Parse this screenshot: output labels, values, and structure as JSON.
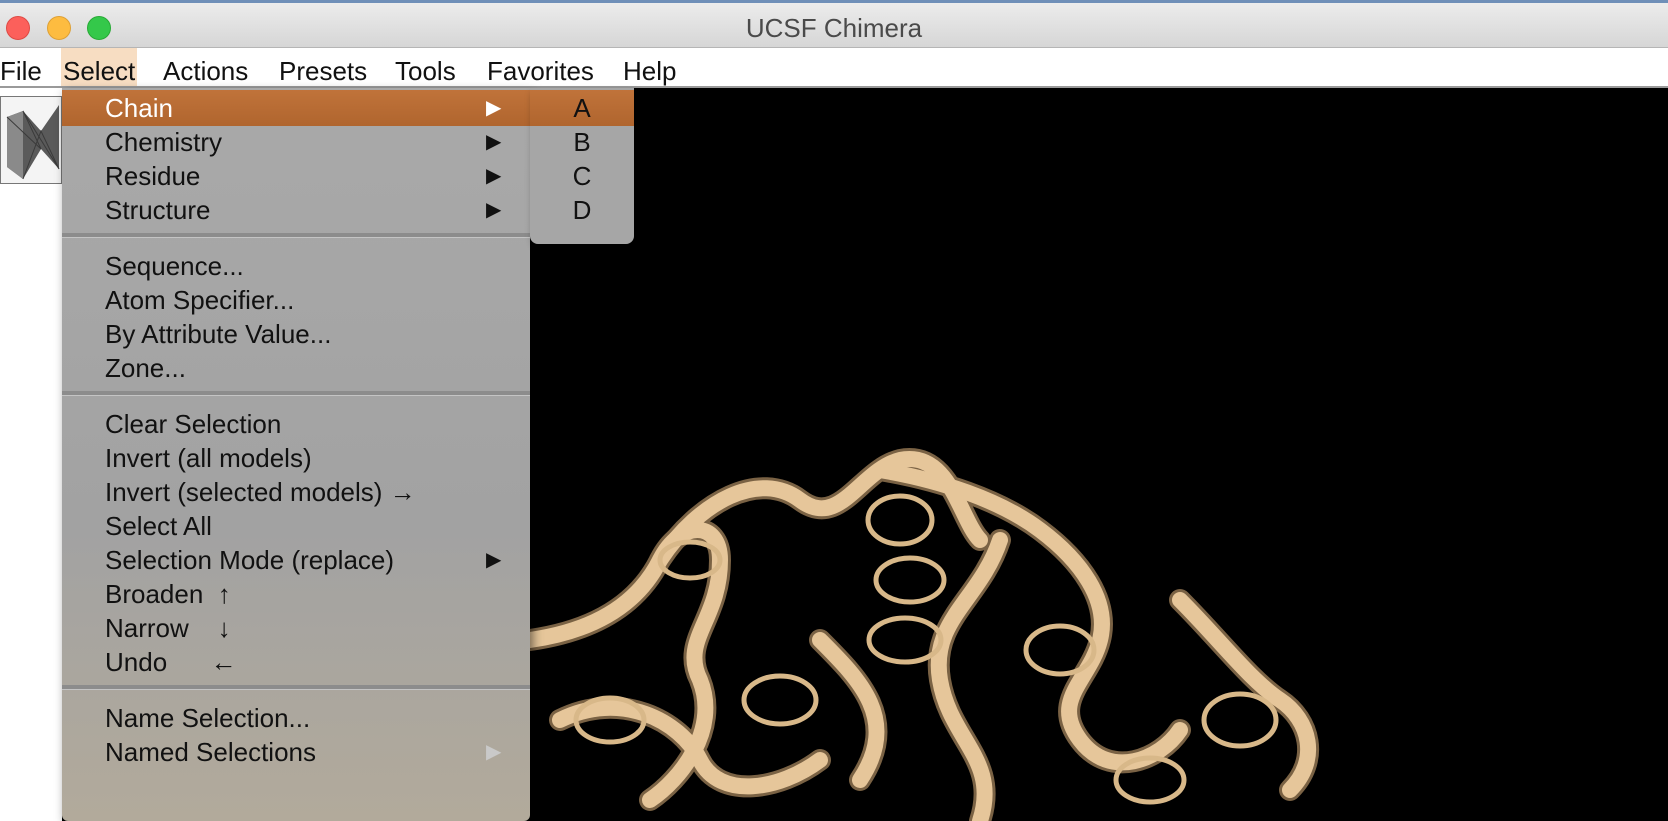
{
  "window": {
    "title": "UCSF Chimera",
    "controls": [
      "close-icon",
      "minimize-icon",
      "zoom-icon"
    ]
  },
  "menubar": {
    "items": [
      "File",
      "Select",
      "Actions",
      "Presets",
      "Tools",
      "Favorites",
      "Help"
    ],
    "active": "Select"
  },
  "select_menu": {
    "groups": [
      [
        {
          "label": "Chain",
          "submenu": true,
          "highlighted": true
        },
        {
          "label": "Chemistry",
          "submenu": true
        },
        {
          "label": "Residue",
          "submenu": true
        },
        {
          "label": "Structure",
          "submenu": true
        }
      ],
      [
        {
          "label": "Sequence..."
        },
        {
          "label": "Atom Specifier..."
        },
        {
          "label": "By Attribute Value..."
        },
        {
          "label": "Zone..."
        }
      ],
      [
        {
          "label": "Clear Selection"
        },
        {
          "label": "Invert (all models)"
        },
        {
          "label": "Invert (selected models) →"
        },
        {
          "label": "Select All"
        },
        {
          "label": "Selection Mode (replace)",
          "submenu": true
        },
        {
          "label": "Broaden  ↑"
        },
        {
          "label": "Narrow    ↓"
        },
        {
          "label": "Undo      ←"
        }
      ],
      [
        {
          "label": "Name Selection..."
        },
        {
          "label": "Named Selections",
          "submenu": true,
          "disabled": true
        }
      ]
    ],
    "submenu_arrow": "▶"
  },
  "chain_submenu": {
    "items": [
      "A",
      "B",
      "C",
      "D"
    ],
    "highlighted": "A"
  },
  "colors": {
    "highlight": "#b86a33",
    "menu_bg": "#a6a6a6",
    "ribbon": "#e9c99b",
    "viewport_bg": "#000000"
  }
}
